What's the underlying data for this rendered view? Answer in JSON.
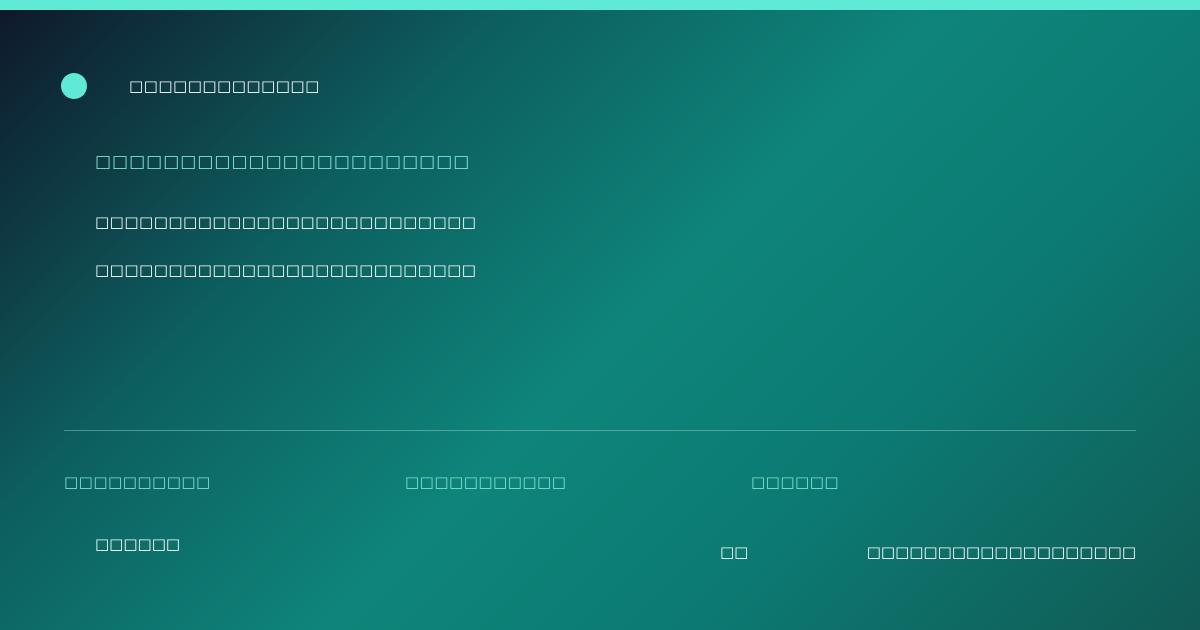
{
  "colors": {
    "accent": "#5eead4",
    "label": "#7fe3cf",
    "text": "#ffffff",
    "background_start": "#0f172a",
    "background_mid": "#0e857a",
    "background_end": "#115a55"
  },
  "brand": {
    "icon": "brand-dot-icon",
    "name": "□□□□□□□□□□□□□"
  },
  "hero": {
    "headline": "□□□□□□□□□□□□□□□□□□□□□□",
    "description_lines": [
      "□□□□□□□□□□□□□□□□□□□□□□□□□□",
      "□□□□□□□□□□□□□□□□□□□□□□□□□□"
    ]
  },
  "meta": {
    "labels": [
      "□□□□□□□□□□",
      "□□□□□□□□□□□",
      "□□□□□□"
    ]
  },
  "footer": {
    "left": "□□□□□□",
    "middle": "□□",
    "right": "□□□□□□□□□□□□□□□□□□□"
  }
}
